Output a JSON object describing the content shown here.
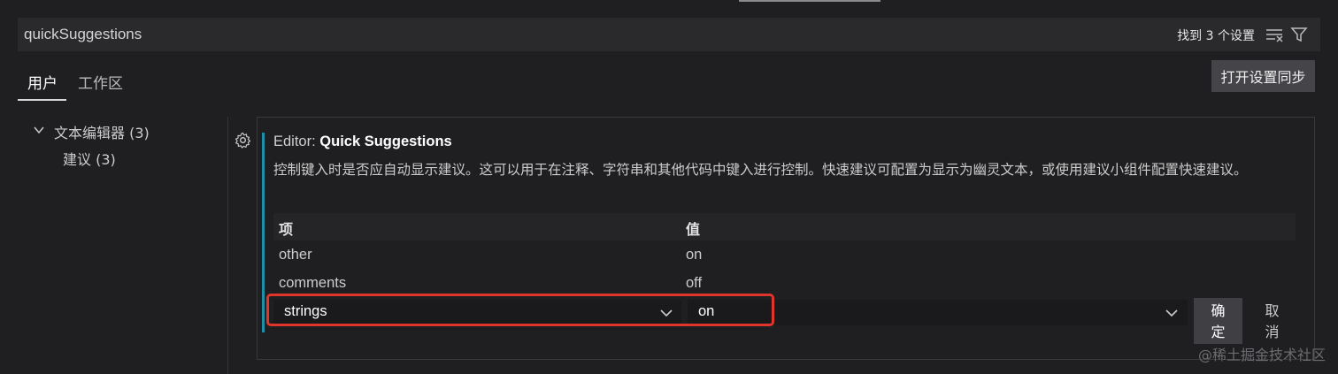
{
  "search": {
    "value": "quickSuggestions",
    "found": "找到 3 个设置"
  },
  "tabs": [
    {
      "label": "用户"
    },
    {
      "label": "工作区"
    }
  ],
  "sync_button": "打开设置同步",
  "tree": {
    "category": "文本编辑器 (3)",
    "subcategory": "建议 (3)"
  },
  "setting": {
    "title_prefix": "Editor: ",
    "title_name": "Quick Suggestions",
    "description": "控制键入时是否应自动显示建议。这可以用于在注释、字符串和其他代码中键入进行控制。快速建议可配置为显示为幽灵文本，或使用建议小组件配置快速建议。",
    "table": {
      "headers": [
        "项",
        "值"
      ],
      "rows": [
        {
          "key": "other",
          "value": "on"
        },
        {
          "key": "comments",
          "value": "off"
        }
      ],
      "edit_row": {
        "key": "strings",
        "value": "on"
      }
    },
    "ok_button": "确\n定",
    "cancel_button": "取\n消"
  },
  "watermark": "@稀土掘金技术社区",
  "colors": {
    "accent": "#1d8fa6",
    "highlight_outline": "#e0352b",
    "background": "#1f1f21"
  }
}
